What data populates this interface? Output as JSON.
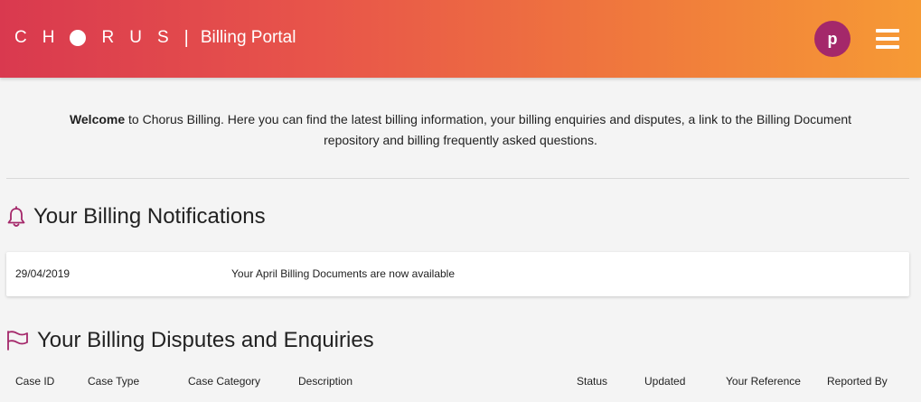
{
  "header": {
    "logo_letters": [
      "C",
      "H",
      "R",
      "U",
      "S"
    ],
    "separator": "|",
    "title": "Billing Portal",
    "avatar_initial": "p",
    "gradient_start": "#d9394f",
    "gradient_end": "#f69a35",
    "avatar_color": "#a4286a"
  },
  "welcome": {
    "bold": "Welcome",
    "text": " to Chorus Billing. Here you can find the latest billing information, your billing enquiries and disputes, a link to the Billing Document repository and billing frequently asked questions."
  },
  "notifications": {
    "title": "Your Billing Notifications",
    "icon": "bell-icon",
    "items": [
      {
        "date": "29/04/2019",
        "message": "Your April Billing Documents are now available"
      }
    ]
  },
  "disputes": {
    "title": "Your Billing Disputes and Enquiries",
    "icon": "flag-icon",
    "columns": {
      "case_id": "Case ID",
      "case_type": "Case Type",
      "case_category": "Case Category",
      "description": "Description",
      "status": "Status",
      "updated": "Updated",
      "your_reference": "Your Reference",
      "reported_by": "Reported By"
    }
  }
}
